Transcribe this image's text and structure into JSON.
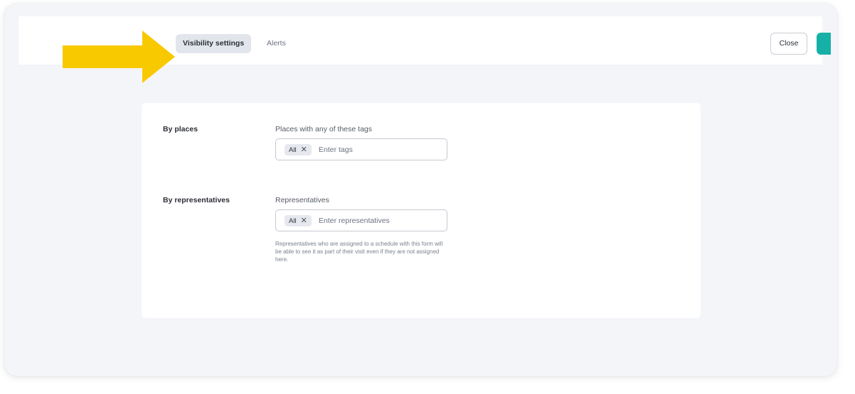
{
  "header": {
    "tabs": [
      {
        "label": "Visibility settings",
        "active": true
      },
      {
        "label": "Alerts",
        "active": false
      }
    ],
    "close_label": "Close",
    "accent_color": "#17b0a7",
    "pointer_arrow_color": "#f9c900"
  },
  "form": {
    "places": {
      "row_label": "By places",
      "field_label": "Places with any of these tags",
      "chip": "All",
      "placeholder": "Enter tags"
    },
    "representatives": {
      "row_label": "By representatives",
      "field_label": "Representatives",
      "chip": "All",
      "placeholder": "Enter representatives",
      "help_text": "Representatives who are assigned to a schedule with this form will be able to see it as part of their visit even if they are not assigned here."
    }
  }
}
